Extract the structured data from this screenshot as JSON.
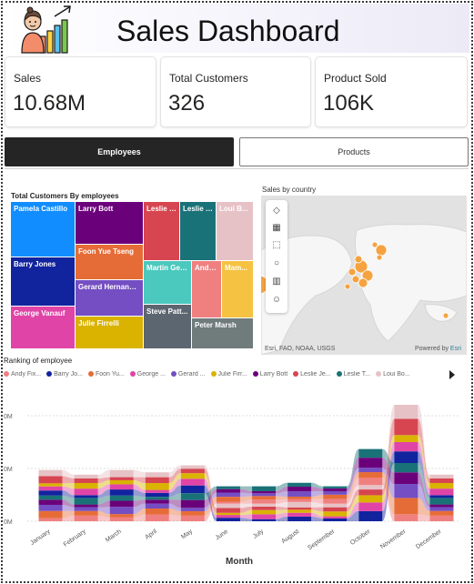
{
  "header": {
    "title": "Sales Dashboard"
  },
  "kpis": [
    {
      "label": "Sales",
      "value": "10.68M"
    },
    {
      "label": "Total Customers",
      "value": "326"
    },
    {
      "label": "Product Sold",
      "value": "106K"
    }
  ],
  "tabs": {
    "active": "Employees",
    "inactive": "Products"
  },
  "treemap": {
    "title": "Total Customers By employees",
    "cells": [
      {
        "label": "Pamela Castillo",
        "color": "#118DFF"
      },
      {
        "label": "Barry Jones",
        "color": "#12239E"
      },
      {
        "label": "George Vanauf",
        "color": "#E044A7"
      },
      {
        "label": "Larry Bott",
        "color": "#6B007B"
      },
      {
        "label": "Foon Yue Tseng",
        "color": "#E66C37"
      },
      {
        "label": "Gerard Hernandez",
        "color": "#744EC2"
      },
      {
        "label": "Julie Firrelli",
        "color": "#D9B300"
      },
      {
        "label": "Leslie J...",
        "color": "#D64550"
      },
      {
        "label": "Leslie T...",
        "color": "#197278"
      },
      {
        "label": "Loui B...",
        "color": "#E6C2C6"
      },
      {
        "label": "Martin Ger...",
        "color": "#4CC9BE"
      },
      {
        "label": "Andy...",
        "color": "#F08080"
      },
      {
        "label": "Mam...",
        "color": "#F5C242"
      },
      {
        "label": "Steve Patt...",
        "color": "#5C6670"
      },
      {
        "label": "Peter Marsh",
        "color": "#707B7C"
      }
    ]
  },
  "map": {
    "title": "Sales by country",
    "attribution": "Esri, FAO, NOAA, USGS",
    "powered": "Powered by",
    "powered_brand": "Esri",
    "tool_icons": [
      "layers-icon",
      "qr-icon",
      "select-rect-icon",
      "search-icon",
      "bar-chart-icon",
      "person-icon"
    ]
  },
  "chart_data": {
    "type": "area",
    "title": "Ranking of employee",
    "xlabel": "Month",
    "ylabel": "",
    "categories": [
      "January",
      "February",
      "March",
      "April",
      "May",
      "June",
      "July",
      "August",
      "September",
      "October",
      "November",
      "December"
    ],
    "ytick_labels": [
      "0M",
      "0M",
      "0M"
    ],
    "totals": [
      0.44,
      0.4,
      0.44,
      0.42,
      0.48,
      0.3,
      0.3,
      0.33,
      0.3,
      0.62,
      1.0,
      0.4
    ],
    "series": [
      {
        "name": "Andy Fix...",
        "color": "#F08080"
      },
      {
        "name": "Barry Jo...",
        "color": "#12239E"
      },
      {
        "name": "Foon Yu...",
        "color": "#E66C37"
      },
      {
        "name": "George ...",
        "color": "#E044A7"
      },
      {
        "name": "Gerard ...",
        "color": "#744EC2"
      },
      {
        "name": "Julie Firr...",
        "color": "#D9B300"
      },
      {
        "name": "Larry Bott",
        "color": "#6B007B"
      },
      {
        "name": "Leslie Je...",
        "color": "#D64550"
      },
      {
        "name": "Leslie T...",
        "color": "#197278"
      },
      {
        "name": "Loui Bo...",
        "color": "#E6C2C6"
      }
    ]
  }
}
